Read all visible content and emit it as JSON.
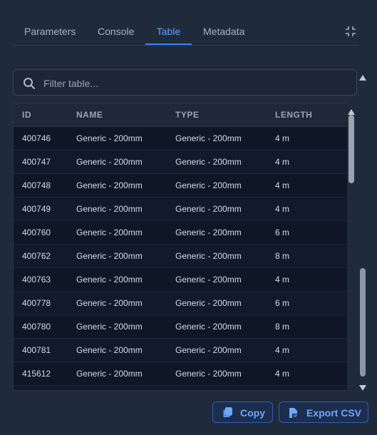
{
  "tabs": [
    {
      "label": "Parameters",
      "active": false
    },
    {
      "label": "Console",
      "active": false
    },
    {
      "label": "Table",
      "active": true
    },
    {
      "label": "Metadata",
      "active": false
    }
  ],
  "filter": {
    "placeholder": "Filter table...",
    "value": ""
  },
  "table": {
    "columns": [
      "ID",
      "NAME",
      "TYPE",
      "LENGTH"
    ],
    "rows": [
      {
        "id": "400746",
        "name": "Generic - 200mm",
        "type": "Generic - 200mm",
        "length": "4 m"
      },
      {
        "id": "400747",
        "name": "Generic - 200mm",
        "type": "Generic - 200mm",
        "length": "4 m"
      },
      {
        "id": "400748",
        "name": "Generic - 200mm",
        "type": "Generic - 200mm",
        "length": "4 m"
      },
      {
        "id": "400749",
        "name": "Generic - 200mm",
        "type": "Generic - 200mm",
        "length": "4 m"
      },
      {
        "id": "400760",
        "name": "Generic - 200mm",
        "type": "Generic - 200mm",
        "length": "6 m"
      },
      {
        "id": "400762",
        "name": "Generic - 200mm",
        "type": "Generic - 200mm",
        "length": "8 m"
      },
      {
        "id": "400763",
        "name": "Generic - 200mm",
        "type": "Generic - 200mm",
        "length": "4 m"
      },
      {
        "id": "400778",
        "name": "Generic - 200mm",
        "type": "Generic - 200mm",
        "length": "6 m"
      },
      {
        "id": "400780",
        "name": "Generic - 200mm",
        "type": "Generic - 200mm",
        "length": "8 m"
      },
      {
        "id": "400781",
        "name": "Generic - 200mm",
        "type": "Generic - 200mm",
        "length": "4 m"
      },
      {
        "id": "415612",
        "name": "Generic - 200mm",
        "type": "Generic - 200mm",
        "length": "4 m"
      },
      {
        "id": "",
        "name": "",
        "type": "",
        "length": ""
      }
    ]
  },
  "actions": {
    "copy_label": "Copy",
    "export_label": "Export CSV"
  },
  "icons": {
    "collapse": "collapse-icon",
    "search": "search-icon",
    "copy": "copy-icon",
    "export": "csv-file-icon"
  },
  "colors": {
    "accent": "#3b82f6",
    "background": "#1f2a3b",
    "table_bg": "#0f1726"
  }
}
